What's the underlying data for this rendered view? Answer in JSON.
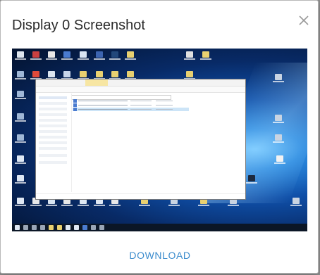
{
  "dialog": {
    "title": "Display 0 Screenshot",
    "close_icon": "close-icon",
    "download_label": "DOWNLOAD"
  },
  "colors": {
    "accent": "#3c8ccd",
    "title_text": "#2b2b2b",
    "desktop_blue": "#0f4fa8",
    "taskbar": "#0b1626"
  },
  "screenshot": {
    "content": "Windows desktop with icons, an open File Explorer window listing three application files, and a taskbar"
  }
}
